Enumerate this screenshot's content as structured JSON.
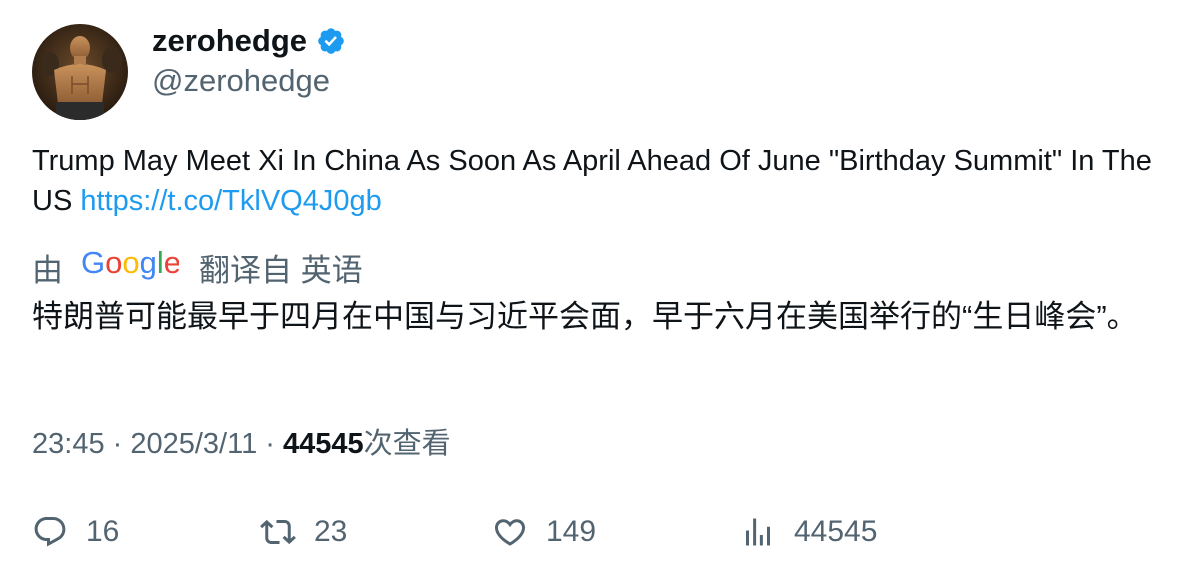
{
  "author": {
    "display_name": "zerohedge",
    "handle": "@zerohedge",
    "verified": true,
    "avatar_icon": "avatar-photo"
  },
  "tweet": {
    "text": "Trump May Meet Xi In China As Soon As April Ahead Of June \"Birthday Summit\" In The US ",
    "link": "https://t.co/TklVQ4J0gb",
    "link_color": "#1d9bf0"
  },
  "translation": {
    "prefix": "由",
    "brand": "Google",
    "suffix": "翻译自 英语",
    "text": "特朗普可能最早于四月在中国与习近平会面，早于六月在美国举行的“生日峰会”。"
  },
  "meta": {
    "time": "23:45",
    "separator1": " · ",
    "date": "2025/3/11",
    "separator2": " · ",
    "views": "44545",
    "views_label": "次查看"
  },
  "actions": {
    "replies": "16",
    "reposts": "23",
    "likes": "149",
    "views": "44545"
  },
  "colors": {
    "text": "#0f1419",
    "secondary": "#536471",
    "accent": "#1d9bf0",
    "verified": "#1d9bf0"
  }
}
